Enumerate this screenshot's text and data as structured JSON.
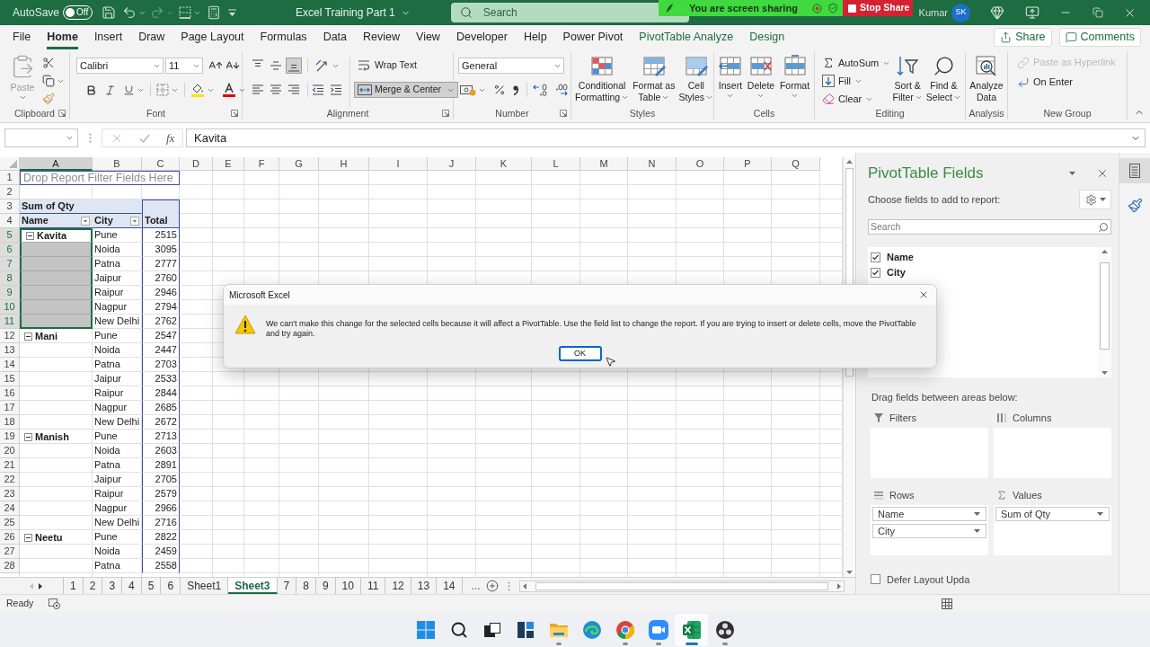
{
  "title_bar": {
    "autosave_label": "AutoSave",
    "autosave_toggle": {
      "label": "Off",
      "on": false
    },
    "document_title": "Excel Training Part 1",
    "search": {
      "placeholder": "Search"
    },
    "user_name": "Kumar",
    "avatar_initials": "SK"
  },
  "screen_share": {
    "message": "You are screen sharing",
    "stop_button": "Stop Share"
  },
  "ribbon_tabs": [
    {
      "label": "File",
      "selected": false,
      "kind": "standard"
    },
    {
      "label": "Home",
      "selected": true,
      "kind": "standard"
    },
    {
      "label": "Insert",
      "selected": false,
      "kind": "standard"
    },
    {
      "label": "Draw",
      "selected": false,
      "kind": "standard"
    },
    {
      "label": "Page Layout",
      "selected": false,
      "kind": "standard"
    },
    {
      "label": "Formulas",
      "selected": false,
      "kind": "standard"
    },
    {
      "label": "Data",
      "selected": false,
      "kind": "standard"
    },
    {
      "label": "Review",
      "selected": false,
      "kind": "standard"
    },
    {
      "label": "View",
      "selected": false,
      "kind": "standard"
    },
    {
      "label": "Developer",
      "selected": false,
      "kind": "standard"
    },
    {
      "label": "Help",
      "selected": false,
      "kind": "standard"
    },
    {
      "label": "Power Pivot",
      "selected": false,
      "kind": "standard"
    },
    {
      "label": "PivotTable Analyze",
      "selected": false,
      "kind": "contextual"
    },
    {
      "label": "Design",
      "selected": false,
      "kind": "contextual"
    }
  ],
  "header_buttons": {
    "share": "Share",
    "comments": "Comments"
  },
  "ribbon": {
    "clipboard": {
      "label": "Clipboard",
      "paste": {
        "label": "Paste",
        "disabled": true
      }
    },
    "font": {
      "label": "Font",
      "font_name": "Calibri",
      "font_size": "11"
    },
    "alignment": {
      "label": "Alignment",
      "vertical_align": [
        {
          "kind": "top",
          "selected": false
        },
        {
          "kind": "middle",
          "selected": false
        },
        {
          "kind": "bottom",
          "selected": true
        }
      ],
      "wrap_text": "Wrap Text",
      "merge_center": {
        "label": "Merge & Center",
        "selected": true
      }
    },
    "number": {
      "label": "Number",
      "format": "General"
    },
    "styles": {
      "label": "Styles",
      "buttons": [
        {
          "kind": "conditional",
          "lines": [
            "Conditional",
            "Formatting"
          ]
        },
        {
          "kind": "table",
          "lines": [
            "Format as",
            "Table"
          ]
        },
        {
          "kind": "cell_styles",
          "lines": [
            "Cell",
            "Styles"
          ]
        }
      ]
    },
    "cells": {
      "label": "Cells",
      "buttons": [
        {
          "kind": "insert",
          "label": "Insert"
        },
        {
          "kind": "delete",
          "label": "Delete"
        },
        {
          "kind": "format",
          "label": "Format"
        }
      ]
    },
    "editing": {
      "label": "Editing",
      "small_buttons": [
        {
          "kind": "autosum",
          "label": "AutoSum"
        },
        {
          "kind": "fill",
          "label": "Fill"
        },
        {
          "kind": "clear",
          "label": "Clear"
        }
      ],
      "big_buttons": [
        {
          "kind": "sort",
          "lines": [
            "Sort &",
            "Filter"
          ]
        },
        {
          "kind": "find",
          "lines": [
            "Find &",
            "Select"
          ]
        }
      ]
    },
    "analysis": {
      "label": "Analysis",
      "button": {
        "lines": [
          "Analyze",
          "Data"
        ]
      }
    },
    "new_group": {
      "label": "New Group",
      "buttons": [
        {
          "kind": "hyperlink",
          "label": "Paste as Hyperlink",
          "disabled": true
        },
        {
          "kind": "enter",
          "label": "On Enter",
          "disabled": false
        }
      ]
    }
  },
  "formula_bar": {
    "function_button": "fx",
    "value": "Kavita"
  },
  "sheet": {
    "columns": [
      {
        "label": "A",
        "selected": true
      },
      {
        "label": "B",
        "selected": false
      },
      {
        "label": "C",
        "selected": false
      },
      {
        "label": "D",
        "selected": false
      },
      {
        "label": "E",
        "selected": false
      },
      {
        "label": "F",
        "selected": false
      },
      {
        "label": "G",
        "selected": false
      },
      {
        "label": "H",
        "selected": false
      },
      {
        "label": "I",
        "selected": false
      },
      {
        "label": "J",
        "selected": false
      },
      {
        "label": "K",
        "selected": false
      },
      {
        "label": "L",
        "selected": false
      },
      {
        "label": "M",
        "selected": false
      },
      {
        "label": "N",
        "selected": false
      },
      {
        "label": "O",
        "selected": false
      },
      {
        "label": "P",
        "selected": false
      },
      {
        "label": "Q",
        "selected": false
      }
    ],
    "rows": [
      {
        "label": "1",
        "selected": false
      },
      {
        "label": "2",
        "selected": false
      },
      {
        "label": "3",
        "selected": false
      },
      {
        "label": "4",
        "selected": false
      },
      {
        "label": "5",
        "selected": true
      },
      {
        "label": "6",
        "selected": true
      },
      {
        "label": "7",
        "selected": true
      },
      {
        "label": "8",
        "selected": true
      },
      {
        "label": "9",
        "selected": true
      },
      {
        "label": "10",
        "selected": true
      },
      {
        "label": "11",
        "selected": true
      },
      {
        "label": "12",
        "selected": false
      },
      {
        "label": "13",
        "selected": false
      },
      {
        "label": "14",
        "selected": false
      },
      {
        "label": "15",
        "selected": false
      },
      {
        "label": "16",
        "selected": false
      },
      {
        "label": "17",
        "selected": false
      },
      {
        "label": "18",
        "selected": false
      },
      {
        "label": "19",
        "selected": false
      },
      {
        "label": "20",
        "selected": false
      },
      {
        "label": "21",
        "selected": false
      },
      {
        "label": "22",
        "selected": false
      },
      {
        "label": "23",
        "selected": false
      },
      {
        "label": "24",
        "selected": false
      },
      {
        "label": "25",
        "selected": false
      },
      {
        "label": "26",
        "selected": false
      },
      {
        "label": "27",
        "selected": false
      },
      {
        "label": "28",
        "selected": false
      }
    ]
  },
  "pivot_table": {
    "filter_prompt": "Drop Report Filter Fields Here",
    "value_label": "Sum of Qty",
    "headers": [
      "Name",
      "City",
      "Total"
    ],
    "groups": [
      {
        "name": "Kavita",
        "expanded": true,
        "selected": true,
        "rows": [
          {
            "city": "Pune",
            "total": "2515"
          },
          {
            "city": "Noida",
            "total": "3095"
          },
          {
            "city": "Patna",
            "total": "2777"
          },
          {
            "city": "Jaipur",
            "total": "2760"
          },
          {
            "city": "Raipur",
            "total": "2946"
          },
          {
            "city": "Nagpur",
            "total": "2794"
          },
          {
            "city": "New Delhi",
            "total": "2762"
          }
        ]
      },
      {
        "name": "Mani",
        "expanded": true,
        "selected": false,
        "rows": [
          {
            "city": "Pune",
            "total": "2547"
          },
          {
            "city": "Noida",
            "total": "2447"
          },
          {
            "city": "Patna",
            "total": "2703"
          },
          {
            "city": "Jaipur",
            "total": "2533"
          },
          {
            "city": "Raipur",
            "total": "2844"
          },
          {
            "city": "Nagpur",
            "total": "2685"
          },
          {
            "city": "New Delhi",
            "total": "2672"
          }
        ]
      },
      {
        "name": "Manish",
        "expanded": true,
        "selected": false,
        "rows": [
          {
            "city": "Pune",
            "total": "2713"
          },
          {
            "city": "Noida",
            "total": "2603"
          },
          {
            "city": "Patna",
            "total": "2891"
          },
          {
            "city": "Jaipur",
            "total": "2705"
          },
          {
            "city": "Raipur",
            "total": "2579"
          },
          {
            "city": "Nagpur",
            "total": "2966"
          },
          {
            "city": "New Delhi",
            "total": "2716"
          }
        ]
      },
      {
        "name": "Neetu",
        "expanded": true,
        "selected": false,
        "rows": [
          {
            "city": "Pune",
            "total": "2822"
          },
          {
            "city": "Noida",
            "total": "2459"
          },
          {
            "city": "Patna",
            "total": "2558"
          }
        ]
      }
    ]
  },
  "dialog": {
    "title": "Microsoft Excel",
    "message": "We can't make this change for the selected cells because it will affect a PivotTable. Use the field list to change the report. If you are trying to insert or delete cells, move the PivotTable and try again.",
    "ok_button": "OK"
  },
  "pivot_fields_pane": {
    "title": "PivotTable Fields",
    "subtitle": "Choose fields to add to report:",
    "search": {
      "placeholder": "Search"
    },
    "fields": [
      {
        "label": "Name",
        "checked": true
      },
      {
        "label": "City",
        "checked": true
      }
    ],
    "areas_hint": "Drag fields between areas below:",
    "areas": [
      {
        "kind": "filters",
        "label": "Filters"
      },
      {
        "kind": "columns",
        "label": "Columns"
      },
      {
        "kind": "rows",
        "label": "Rows",
        "items": [
          "Name",
          "City"
        ]
      },
      {
        "kind": "values",
        "label": "Values",
        "items": [
          "Sum of Qty"
        ]
      }
    ],
    "defer_update": {
      "label": "Defer Layout Upda",
      "checked": false
    }
  },
  "sheet_tabs": {
    "tabs": [
      {
        "label": "1",
        "selected": false
      },
      {
        "label": "2",
        "selected": false
      },
      {
        "label": "3",
        "selected": false
      },
      {
        "label": "4",
        "selected": false
      },
      {
        "label": "5",
        "selected": false
      },
      {
        "label": "6",
        "selected": false
      },
      {
        "label": "Sheet1",
        "selected": false
      },
      {
        "label": "Sheet3",
        "selected": true
      },
      {
        "label": "7",
        "selected": false
      },
      {
        "label": "8",
        "selected": false
      },
      {
        "label": "9",
        "selected": false
      },
      {
        "label": "10",
        "selected": false
      },
      {
        "label": "11",
        "selected": false
      },
      {
        "label": "12",
        "selected": false
      },
      {
        "label": "13",
        "selected": false
      },
      {
        "label": "14",
        "selected": false
      }
    ],
    "more": "..."
  },
  "status_bar": {
    "status": "Ready"
  },
  "taskbar": {
    "apps": [
      {
        "kind": "start",
        "running": false,
        "active": false
      },
      {
        "kind": "search",
        "running": false,
        "active": false
      },
      {
        "kind": "taskview",
        "running": false,
        "active": false
      },
      {
        "kind": "widgets",
        "running": false,
        "active": false
      },
      {
        "kind": "explorer",
        "running": true,
        "active": false
      },
      {
        "kind": "edge",
        "running": false,
        "active": false
      },
      {
        "kind": "chrome",
        "running": true,
        "active": false
      },
      {
        "kind": "zoom",
        "running": true,
        "active": false
      },
      {
        "kind": "excel",
        "running": true,
        "active": true
      },
      {
        "kind": "obs",
        "running": true,
        "active": false
      }
    ]
  }
}
